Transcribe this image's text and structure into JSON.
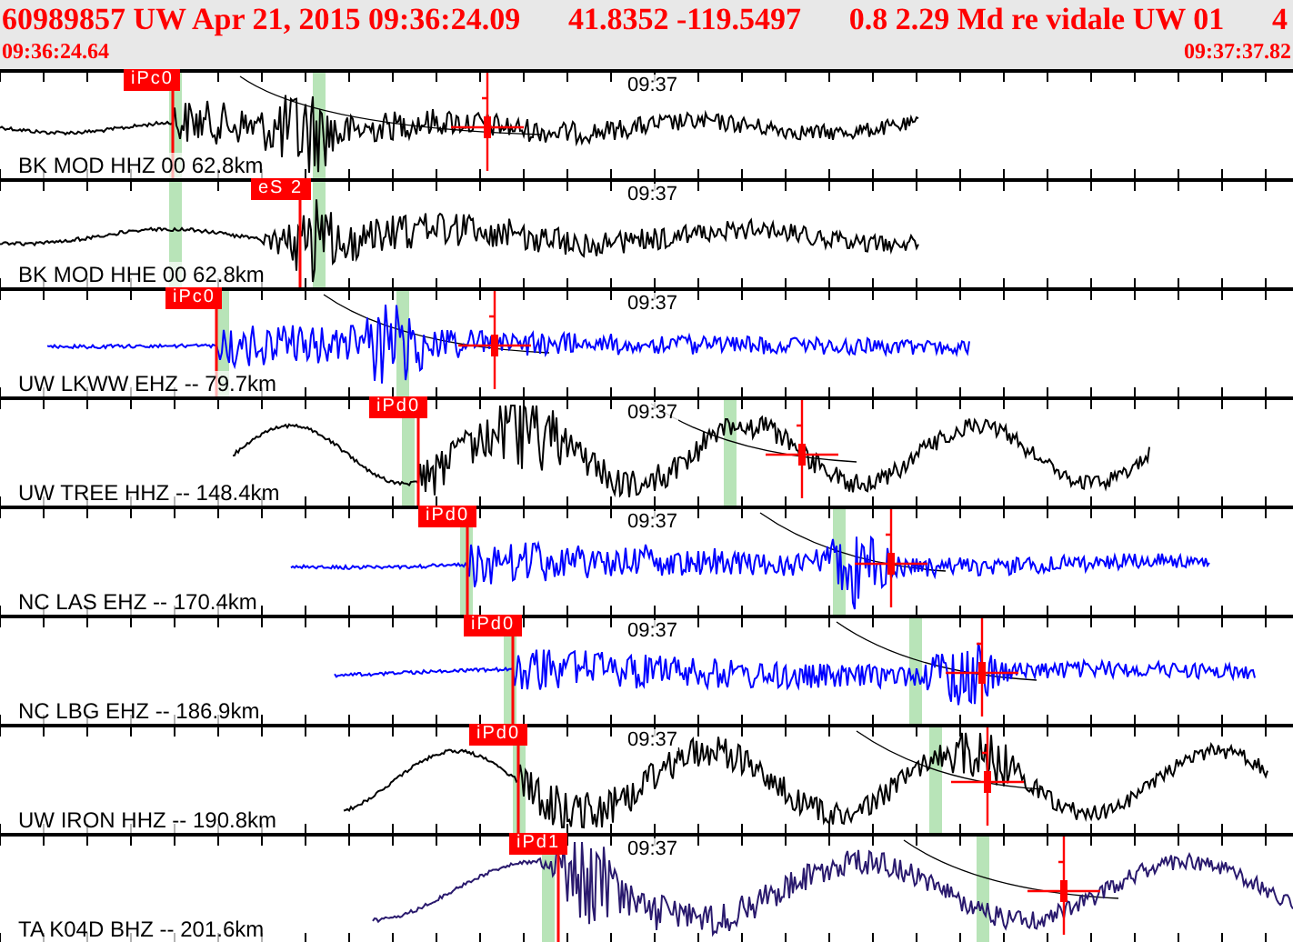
{
  "header": {
    "title_parts": [
      "60989857 UW Apr 21, 2015 09:36:24.09",
      "41.8352 -119.5497",
      "0.8 2.29 Md re vidale UW 01",
      "4"
    ],
    "start_time": "09:36:24.64",
    "end_time": "09:37:37.82"
  },
  "traces": [
    {
      "label": "BK MOD HHZ 00 62.8km",
      "pick": "iPc0",
      "minute_mark": "09:37",
      "color": "#000000"
    },
    {
      "label": "BK MOD HHE 00 62.8km",
      "pick": "eS 2",
      "minute_mark": "09:37",
      "color": "#000000"
    },
    {
      "label": "UW LKWW EHZ -- 79.7km",
      "pick": "iPc0",
      "minute_mark": "09:37",
      "color": "#0000ff"
    },
    {
      "label": "UW TREE HHZ -- 148.4km",
      "pick": "iPd0",
      "minute_mark": "09:37",
      "color": "#000000"
    },
    {
      "label": "NC LAS EHZ -- 170.4km",
      "pick": "iPd0",
      "minute_mark": "09:37",
      "color": "#0000ff"
    },
    {
      "label": "NC LBG EHZ -- 186.9km",
      "pick": "iPd0",
      "minute_mark": "09:37",
      "color": "#0000ff"
    },
    {
      "label": "UW IRON HHZ -- 190.8km",
      "pick": "iPd0",
      "minute_mark": "09:37",
      "color": "#000000"
    },
    {
      "label": "TA K04D BHZ -- 201.6km",
      "pick": "iPd1",
      "minute_mark": "09:37",
      "color": "#2a1a6e"
    }
  ]
}
